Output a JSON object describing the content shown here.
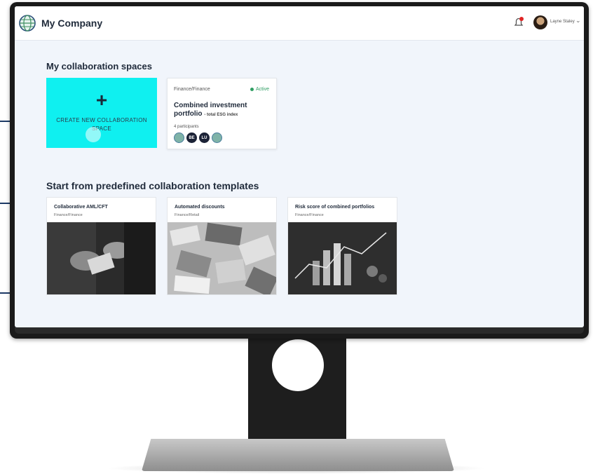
{
  "header": {
    "title": "My Company",
    "user_name": "Layne Staley"
  },
  "spaces_section": {
    "heading": "My collaboration spaces",
    "create_card": {
      "plus": "+",
      "label": "CREATE NEW COLLABORATION SPACE"
    },
    "space_card": {
      "category": "Finance/Finance",
      "status": "Active",
      "title": "Combined investment portfolio",
      "subtitle": "- total ESG index",
      "participants": "4 participants",
      "chips": [
        "",
        "BE",
        "LU",
        ""
      ]
    }
  },
  "templates_section": {
    "heading": "Start from predefined collaboration templates",
    "templates": [
      {
        "title": "Collaborative AML/CFT",
        "category": "Finance/Finance"
      },
      {
        "title": "Automated discounts",
        "category": "Finance/Retail"
      },
      {
        "title": "Risk score of combined portfolios",
        "category": "Finance/Finance"
      }
    ]
  },
  "colors": {
    "accent": "#00f0f0",
    "status_active": "#2f9e63",
    "connector": "#1d3a66"
  }
}
